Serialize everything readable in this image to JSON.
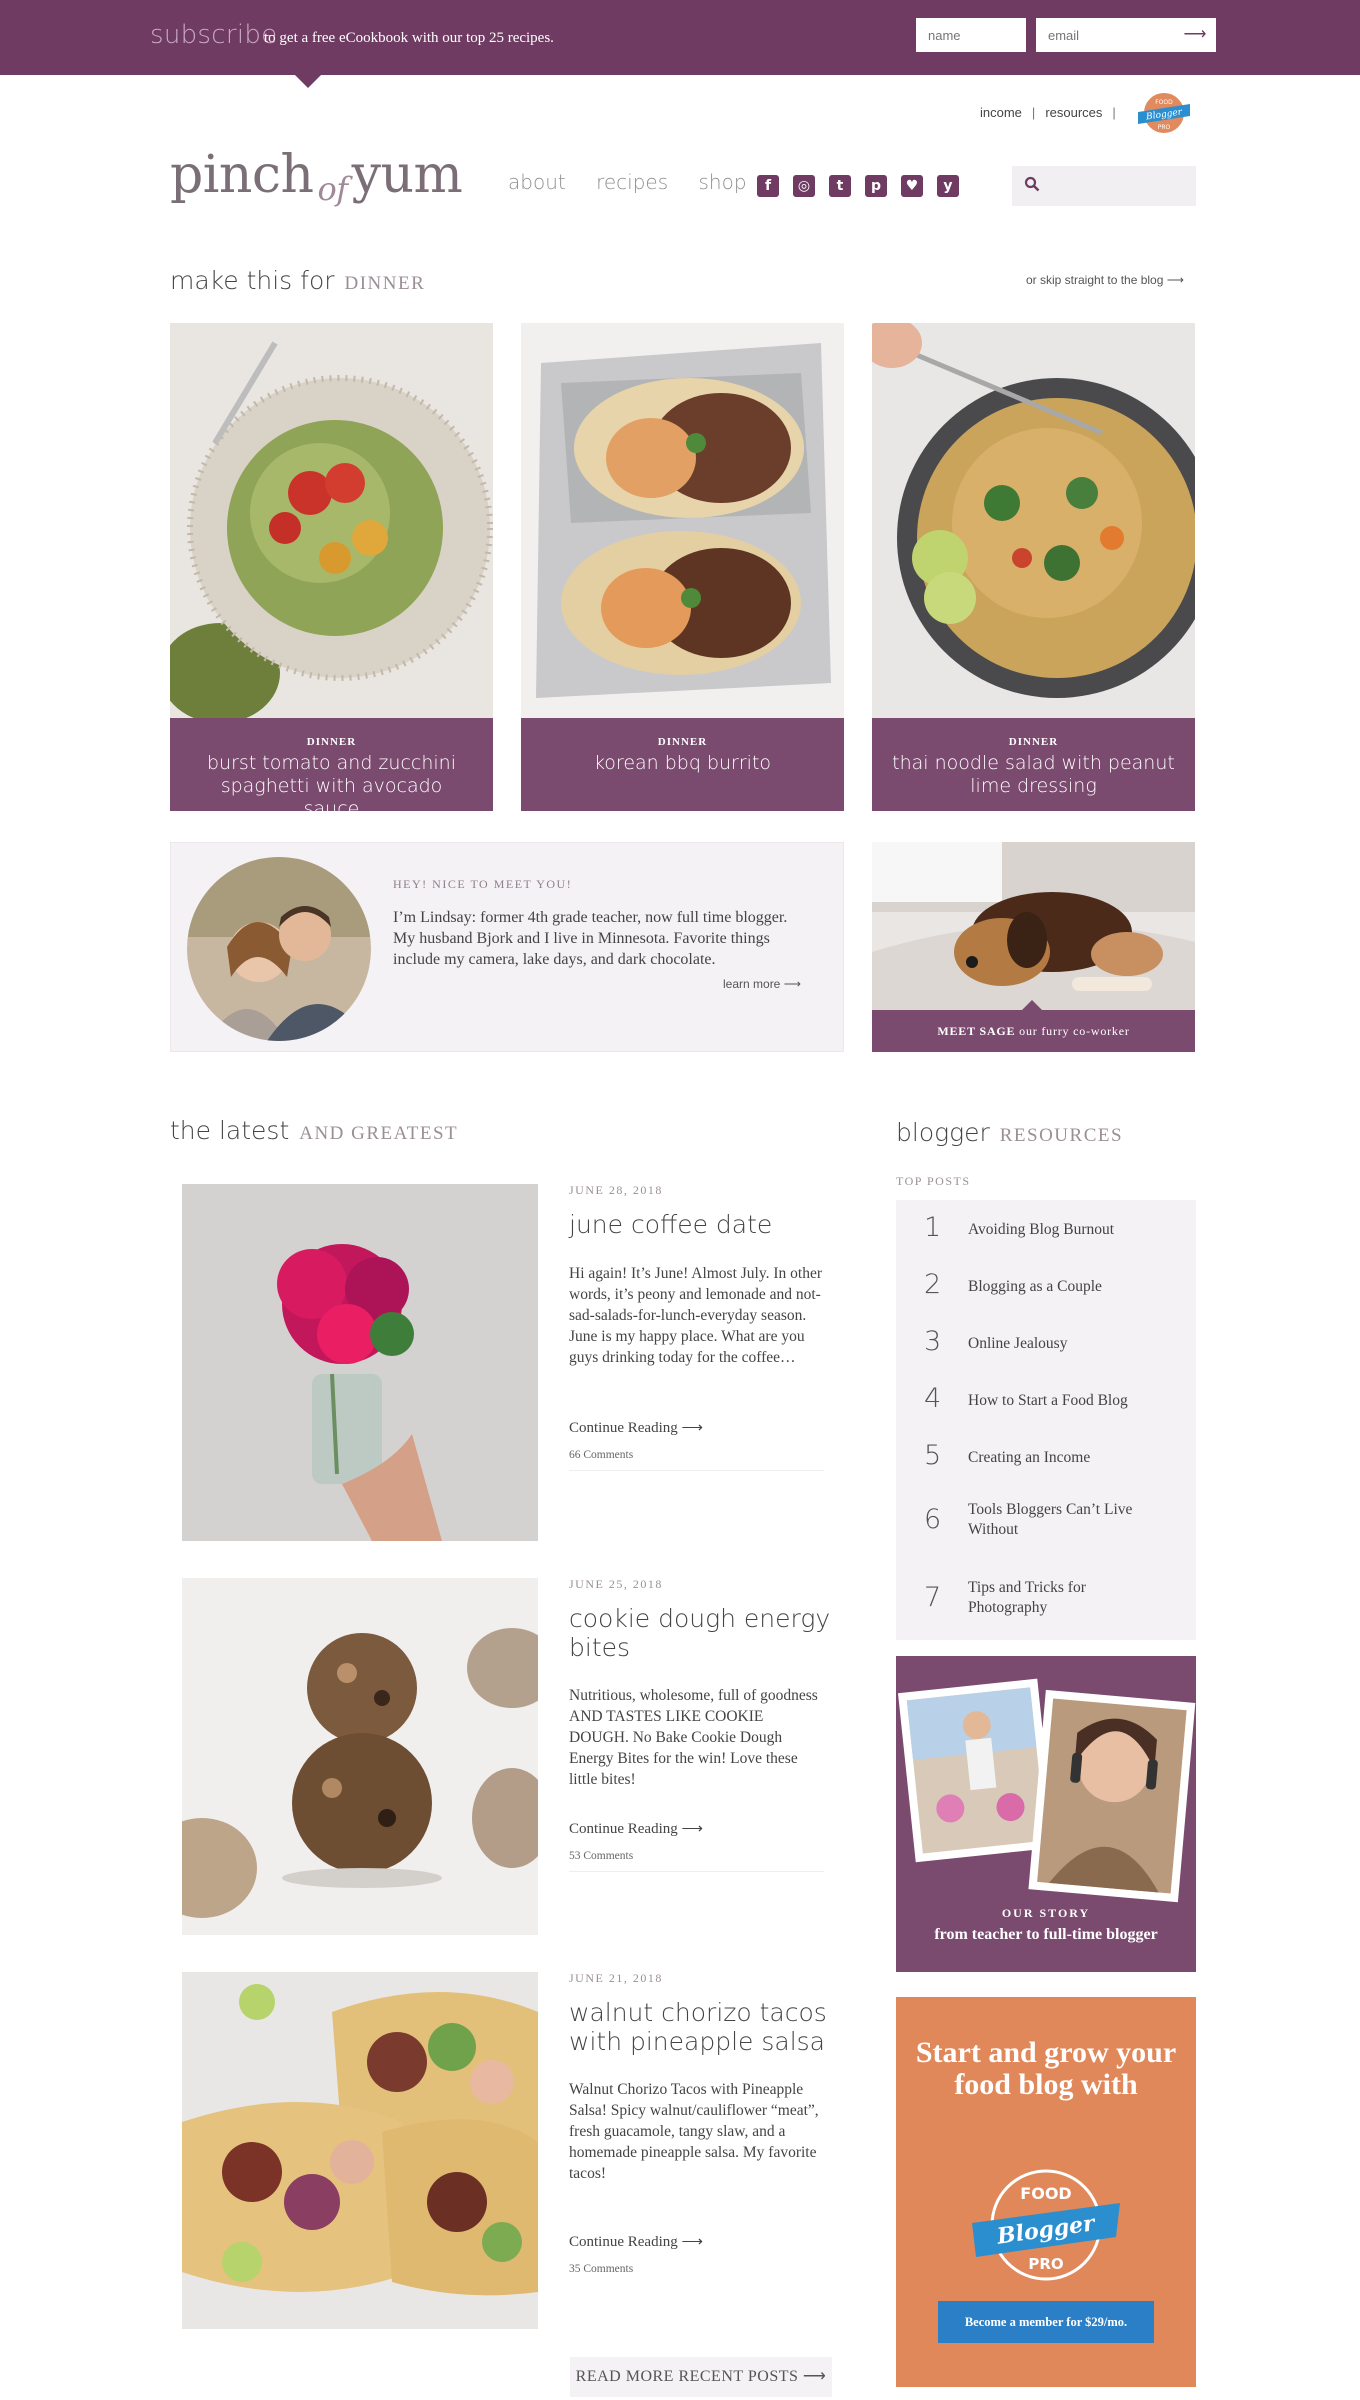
{
  "subscribe_bar": {
    "word": "subscribe",
    "text": "to get a free eCookbook with our top 25 recipes.",
    "name_placeholder": "name",
    "email_placeholder": "email",
    "submit_glyph": "⟶"
  },
  "top_links": [
    "income",
    "resources"
  ],
  "header": {
    "logo_pre": "pinch",
    "logo_of": "of",
    "logo_post": "yum",
    "nav": [
      "about",
      "recipes",
      "shop"
    ],
    "social_icons": [
      "facebook-icon",
      "instagram-icon",
      "twitter-icon",
      "pinterest-icon",
      "bloglovin-icon",
      "yummly-icon"
    ],
    "search_placeholder": ""
  },
  "featured": {
    "title_pre": "make this for",
    "title_caps": "dinner",
    "skip_link": "or skip straight to the blog ⟶",
    "cards": [
      {
        "category": "DINNER",
        "title": "burst tomato and zucchini spaghetti with avocado sauce"
      },
      {
        "category": "DINNER",
        "title": "korean bbq burrito"
      },
      {
        "category": "DINNER",
        "title": "thai noodle salad with peanut lime dressing"
      }
    ]
  },
  "about": {
    "greeting": "HEY! NICE TO MEET YOU!",
    "text": "I’m Lindsay: former 4th grade teacher, now full time blogger. My husband Bjork and I live in Minnesota. Favorite things include my camera, lake days, and dark chocolate.",
    "learn_more": "learn more ⟶"
  },
  "sage": {
    "bold": "MEET SAGE",
    "rest": "our furry co-worker"
  },
  "latest": {
    "title_pre": "the latest",
    "title_caps": "and greatest",
    "posts": [
      {
        "date": "JUNE 28, 2018",
        "title": "june coffee date",
        "excerpt": "Hi again! It’s June! Almost July. In other words, it’s peony and lemonade and not-sad-salads-for-lunch-everyday season. June is my happy place. What are you guys drinking today for the coffee…",
        "continue": "Continue Reading ⟶",
        "comments": "66 Comments"
      },
      {
        "date": "JUNE 25, 2018",
        "title": "cookie dough energy bites",
        "excerpt": "Nutritious, wholesome, full of goodness AND TASTES LIKE COOKIE DOUGH. No Bake Cookie Dough Energy Bites for the win! Love these little bites!",
        "continue": "Continue Reading ⟶",
        "comments": "53 Comments"
      },
      {
        "date": "JUNE 21, 2018",
        "title": "walnut chorizo tacos with pineapple salsa",
        "excerpt": "Walnut Chorizo Tacos with Pineapple Salsa! Spicy walnut/cauliflower “meat”, fresh guacamole, tangy slaw, and a homemade pineapple salsa. My favorite tacos!",
        "continue": "Continue Reading ⟶",
        "comments": "35 Comments"
      }
    ],
    "read_more": "READ MORE RECENT POSTS ⟶"
  },
  "sidebar": {
    "title_pre": "blogger",
    "title_caps": "resources",
    "top_posts_label": "TOP POSTS",
    "top_posts": [
      {
        "num": "1",
        "label": "Avoiding Blog Burnout"
      },
      {
        "num": "2",
        "label": "Blogging as a Couple"
      },
      {
        "num": "3",
        "label": "Online Jealousy"
      },
      {
        "num": "4",
        "label": "How to Start a Food Blog"
      },
      {
        "num": "5",
        "label": "Creating an Income"
      },
      {
        "num": "6",
        "label": "Tools Bloggers Can’t Live Without"
      },
      {
        "num": "7",
        "label": "Tips and Tricks for Photography"
      }
    ],
    "story_kicker": "OUR STORY",
    "story_title": "from teacher to full-time blogger",
    "promo_headline": "Start and grow your food blog with",
    "promo_cta": "Become a member for $29/mo."
  },
  "badge": {
    "line1": "FOOD",
    "line2": "Blogger",
    "line3": "PRO"
  },
  "colors": {
    "brand_plum": "#6f3b63",
    "caption_plum": "#7b4a6f",
    "promo_orange": "#e0885a",
    "cta_blue": "#2b7fc7"
  }
}
